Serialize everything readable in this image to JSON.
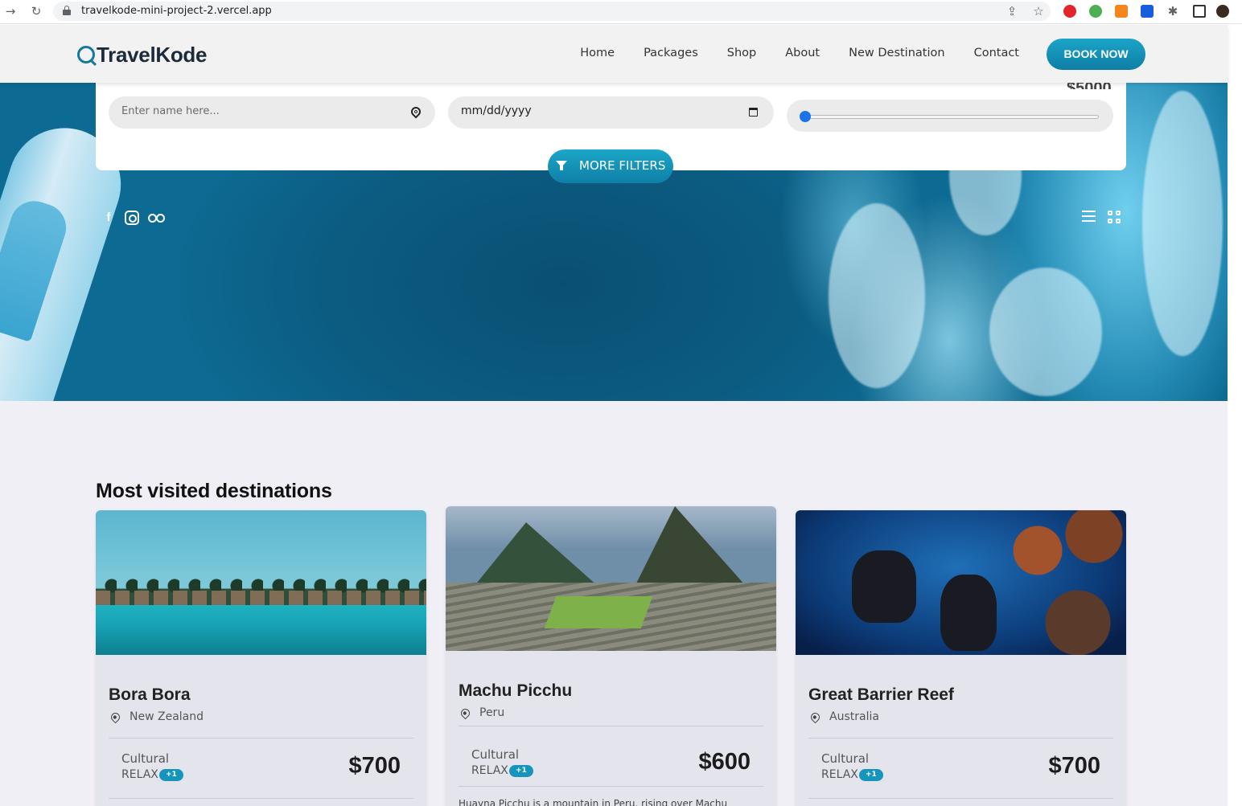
{
  "browser": {
    "url": "travelkode-mini-project-2.vercel.app"
  },
  "nav": {
    "logo": "TravelKode",
    "links": [
      "Home",
      "Packages",
      "Shop",
      "About",
      "New Destination",
      "Contact"
    ],
    "book_button": "BOOK NOW"
  },
  "search": {
    "destination_placeholder": "Enter name here...",
    "date_placeholder": "mm/dd/yyyy",
    "max_price_value": "$5000",
    "slider_level": 0,
    "filters_button": "MORE FILTERS"
  },
  "section": {
    "title": "Most visited destinations"
  },
  "cards": [
    {
      "name": "Bora Bora",
      "location": "New Zealand",
      "category": "Cultural",
      "tag": "RELAX",
      "badge": "+1",
      "price": "$700"
    },
    {
      "name": "Machu Picchu",
      "location": "Peru",
      "category": "Cultural",
      "tag": "RELAX",
      "badge": "+1",
      "price": "$600",
      "description": "Huayna Picchu is a mountain in Peru, rising over Machu"
    },
    {
      "name": "Great Barrier Reef",
      "location": "Australia",
      "category": "Cultural",
      "tag": "RELAX",
      "badge": "+1",
      "price": "$700"
    }
  ],
  "colors": {
    "accent": "#13799e",
    "button_gradient_top": "#1aa5c7",
    "button_gradient_bottom": "#0f7ea5",
    "section_bg": "#f0eff5",
    "card_bg": "#e4e4ed"
  }
}
